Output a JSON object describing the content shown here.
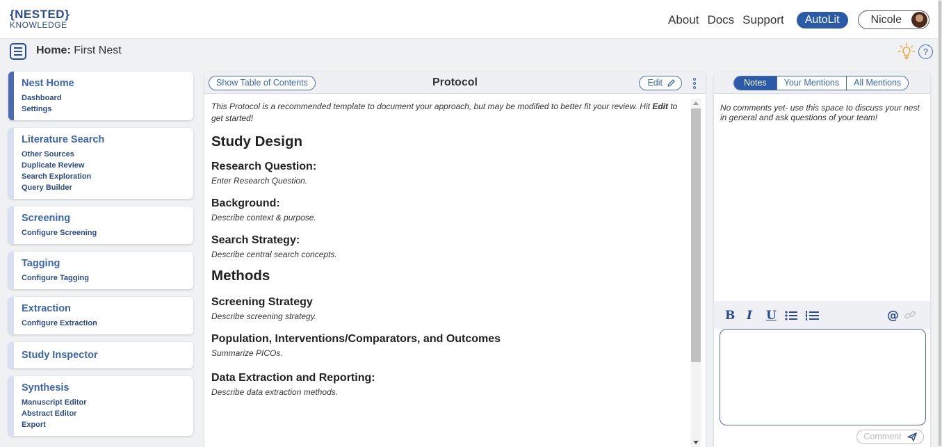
{
  "logo": {
    "line1": "{NESTED}",
    "line2": "KNOWLEDGE"
  },
  "topnav": {
    "about": "About",
    "docs": "Docs",
    "support": "Support",
    "autolit": "AutoLit",
    "user": "Nicole"
  },
  "breadcrumb": {
    "label": "Home:",
    "nest": "First Nest"
  },
  "help_icon": "?",
  "sidebar": [
    {
      "title": "Nest Home",
      "items": [
        "Dashboard",
        "Settings"
      ],
      "active": true
    },
    {
      "title": "Literature Search",
      "items": [
        "Other Sources",
        "Duplicate Review",
        "Search Exploration",
        "Query Builder"
      ]
    },
    {
      "title": "Screening",
      "items": [
        "Configure Screening"
      ]
    },
    {
      "title": "Tagging",
      "items": [
        "Configure Tagging"
      ]
    },
    {
      "title": "Extraction",
      "items": [
        "Configure Extraction"
      ]
    },
    {
      "title": "Study Inspector",
      "items": []
    },
    {
      "title": "Synthesis",
      "items": [
        "Manuscript Editor",
        "Abstract Editor",
        "Export"
      ]
    }
  ],
  "protocol": {
    "toc_button": "Show Table of Contents",
    "title": "Protocol",
    "edit_button": "Edit",
    "intro_part1": "This Protocol is a recommended template to document your approach, but may be modified to better fit your review. Hit ",
    "intro_bold": "Edit",
    "intro_part2": " to get started!",
    "sections": [
      {
        "kind": "h1",
        "text": "Study Design"
      },
      {
        "kind": "h2",
        "text": "Research Question:",
        "placeholder": "Enter Research Question."
      },
      {
        "kind": "h2",
        "text": "Background:",
        "placeholder": "Describe context & purpose."
      },
      {
        "kind": "h2",
        "text": "Search Strategy:",
        "placeholder": "Describe central search concepts."
      },
      {
        "kind": "h1",
        "text": "Methods"
      },
      {
        "kind": "h2",
        "text": "Screening Strategy",
        "placeholder": "Describe screening strategy."
      },
      {
        "kind": "h2",
        "text": "Population, Interventions/Comparators, and Outcomes",
        "placeholder": "Summarize PICOs."
      },
      {
        "kind": "h2",
        "text": "Data Extraction and Reporting:",
        "placeholder": "Describe data extraction methods."
      }
    ]
  },
  "notes": {
    "tabs": [
      "Notes",
      "Your Mentions",
      "All Mentions"
    ],
    "empty_text": "No comments yet- use this space to discuss your nest in general and ask questions of your team!",
    "format_buttons": [
      "B",
      "I",
      "U"
    ],
    "mention_symbol": "@",
    "comment_button": "Comment"
  },
  "colors": {
    "brand": "#2a4b8c",
    "accent": "#2a5aa8",
    "link": "#3a65b3"
  }
}
